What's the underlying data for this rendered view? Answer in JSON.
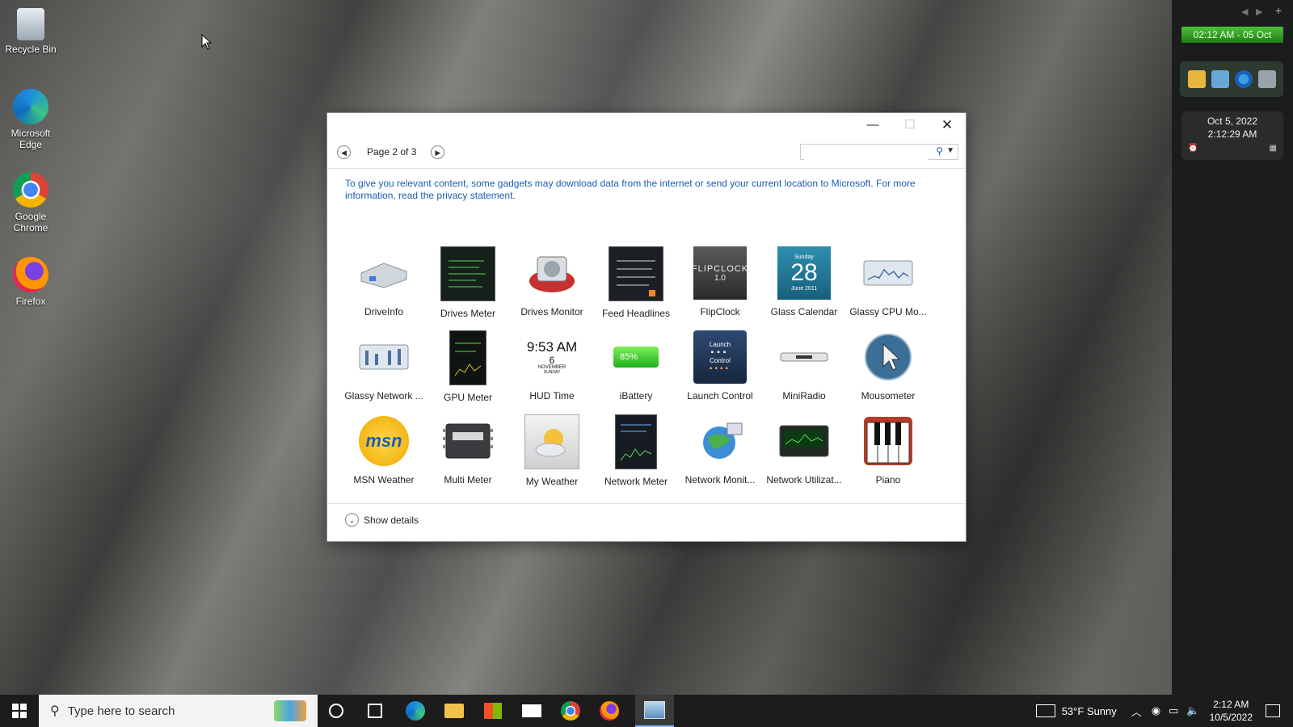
{
  "desktop": {
    "icons": [
      {
        "label": "Recycle Bin",
        "icon": "recycle-bin-icon"
      },
      {
        "label": "Microsoft Edge",
        "icon": "edge-icon"
      },
      {
        "label": "Google Chrome",
        "icon": "chrome-icon"
      },
      {
        "label": "Firefox",
        "icon": "firefox-icon"
      }
    ]
  },
  "sidebar": {
    "clock_text": "02:12 AM - 05 Oct",
    "date_line": "Oct 5, 2022",
    "time_line": "2:12:29 AM",
    "launcher_icons": [
      "folder-icon",
      "monitor-icon",
      "ie-icon",
      "trash-icon"
    ]
  },
  "window": {
    "page_label": "Page 2 of 3",
    "search_placeholder": "",
    "notice": "To give you relevant content, some gadgets may download data from the internet or send your current location to Microsoft. For more information, read the privacy statement.",
    "show_details": "Show details",
    "gadgets": [
      {
        "name": "DriveInfo",
        "icon": "drive-info-icon"
      },
      {
        "name": "Drives Meter",
        "icon": "drives-meter-icon"
      },
      {
        "name": "Drives Monitor",
        "icon": "drives-monitor-icon"
      },
      {
        "name": "Feed Headlines",
        "icon": "feed-headlines-icon"
      },
      {
        "name": "FlipClock",
        "icon": "flipclock-icon"
      },
      {
        "name": "Glass Calendar",
        "icon": "glass-calendar-icon"
      },
      {
        "name": "Glassy CPU Mo...",
        "icon": "glassy-cpu-icon"
      },
      {
        "name": "Glassy Network ...",
        "icon": "glassy-network-icon"
      },
      {
        "name": "GPU Meter",
        "icon": "gpu-meter-icon"
      },
      {
        "name": "HUD Time",
        "icon": "hud-time-icon"
      },
      {
        "name": "iBattery",
        "icon": "ibattery-icon"
      },
      {
        "name": "Launch Control",
        "icon": "launch-control-icon"
      },
      {
        "name": "MiniRadio",
        "icon": "miniradio-icon"
      },
      {
        "name": "Mousometer",
        "icon": "mousometer-icon"
      },
      {
        "name": "MSN Weather",
        "icon": "msn-weather-icon"
      },
      {
        "name": "Multi Meter",
        "icon": "multi-meter-icon"
      },
      {
        "name": "My Weather",
        "icon": "my-weather-icon"
      },
      {
        "name": "Network Meter",
        "icon": "network-meter-icon"
      },
      {
        "name": "Network Monit...",
        "icon": "network-monitor-icon"
      },
      {
        "name": "Network Utilizat...",
        "icon": "network-utilization-icon"
      },
      {
        "name": "Piano",
        "icon": "piano-icon"
      }
    ],
    "gadget_texts": {
      "calendar_day": "28",
      "calendar_top": "Sunday",
      "calendar_bottom": "June 2011",
      "hud_time": "9:53 AM",
      "hud_date_day": "6",
      "hud_date_month": "NOVEMBER",
      "hud_date_weekday": "SUNDAY",
      "battery": "85%",
      "launch_top": "Launch",
      "launch_bottom": "Control",
      "msn": "msn",
      "flipclock": "FLIPCLOCK",
      "flipclock_version": "1.0"
    }
  },
  "taskbar": {
    "search_placeholder": "Type here to search",
    "weather": "53°F  Sunny",
    "time": "2:12 AM",
    "date": "10/5/2022"
  },
  "colors": {
    "accent": "#1a5fb4",
    "taskbar": "#1c1c1c",
    "sidebar_clock": "#3aa82b"
  }
}
